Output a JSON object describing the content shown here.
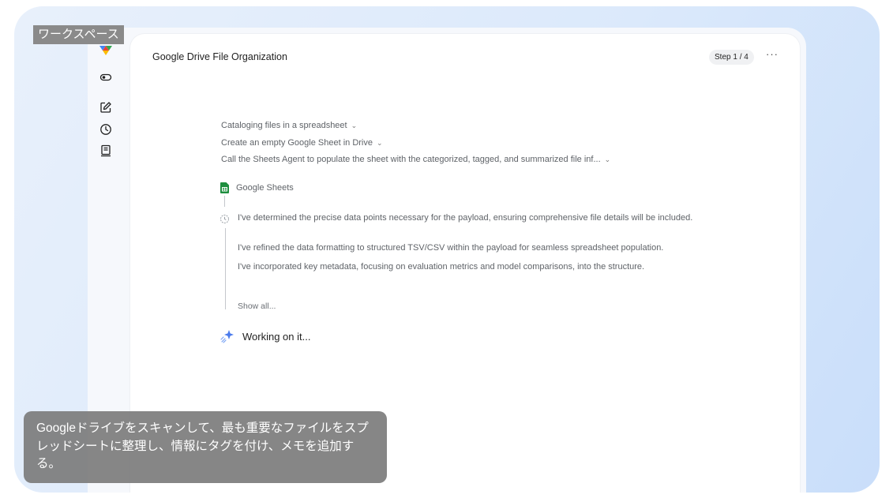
{
  "workspace_tag": "ワークスペース",
  "header": {
    "title": "Google Drive File Organization",
    "step_badge": "Step 1 / 4",
    "more_label": "···"
  },
  "rail": {
    "icons": [
      "google-logo-icon",
      "toggle-icon",
      "edit-icon",
      "history-icon",
      "notes-icon"
    ]
  },
  "steps": [
    {
      "label": "Cataloging files in a spreadsheet",
      "chevron": "⌄"
    },
    {
      "label": "Create an empty Google Sheet in Drive",
      "chevron": "⌄"
    },
    {
      "label": "Call the Sheets Agent to populate the sheet with the categorized, tagged, and summarized file inf...",
      "chevron": "⌄"
    }
  ],
  "tool": {
    "name": "Google Sheets"
  },
  "thoughts": [
    "I've determined the precise data points necessary for the payload, ensuring comprehensive file details will be included.",
    "I've refined the data formatting to structured TSV/CSV within the payload for seamless spreadsheet population.",
    "I've incorporated key metadata, focusing on evaluation metrics and model comparisons, into the structure."
  ],
  "show_all_label": "Show all...",
  "status": {
    "label": "Working on it..."
  },
  "caption": "Googleドライブをスキャンして、最も重要なファイルをスプレッドシートに整理し、情報にタグを付け、メモを追加する。",
  "colors": {
    "sheets_green": "#1e8e3e",
    "sparkle_blue": "#4b7bec"
  }
}
